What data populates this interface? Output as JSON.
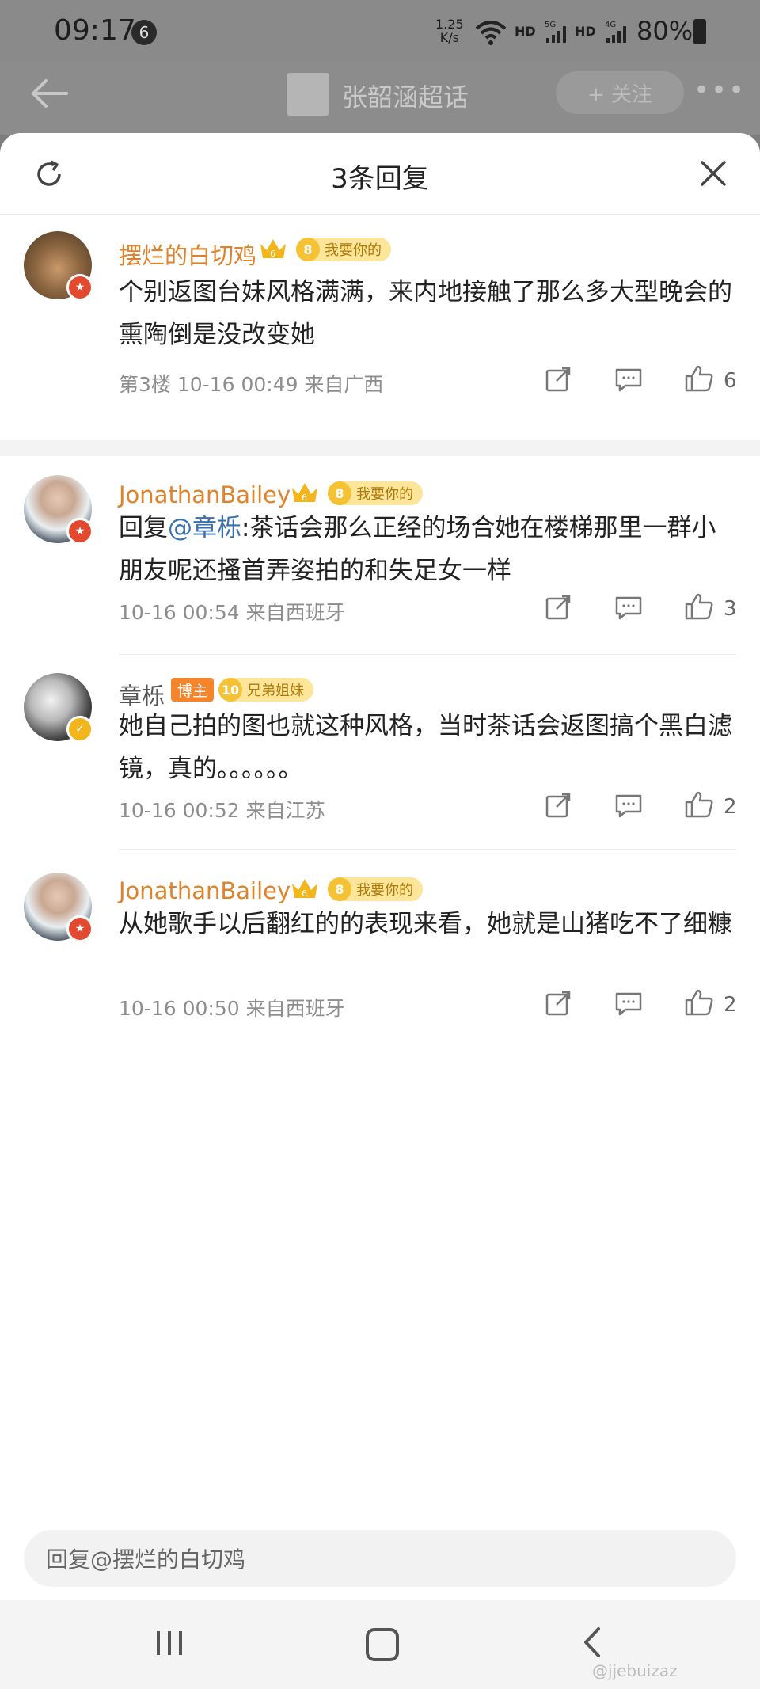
{
  "status_bar": {
    "time": "09:17",
    "notification_count": "6",
    "net_speed_value": "1.25",
    "net_speed_unit": "K/s",
    "hd1": "HD",
    "hd2": "HD",
    "battery": "80%"
  },
  "background_page": {
    "title": "张韶涵超话",
    "follow_label": "+ 关注",
    "more": "•••"
  },
  "sheet": {
    "title": "3条回复"
  },
  "comments": [
    {
      "username": "摆烂的白切鸡",
      "crown_level": "6",
      "fan_level": "8",
      "fan_label": "我要你的",
      "text": "个别返图台妹风格满满，来内地接触了那么多大型晚会的熏陶倒是没改变她",
      "meta": "第3楼 10-16 00:49 来自广西",
      "likes": "6",
      "badge_color": "#e3492f"
    },
    {
      "username": "JonathanBailey",
      "crown_level": "6",
      "fan_level": "8",
      "fan_label": "我要你的",
      "reply_prefix": "回复",
      "mention": "@章栎",
      "text": ":茶话会那么正经的场合她在楼梯那里一群小朋友呢还搔首弄姿拍的和失足女一样",
      "meta": "10-16 00:54 来自西班牙",
      "likes": "3",
      "badge_color": "#e3492f"
    },
    {
      "username": "章栎",
      "blogger_tag": "博主",
      "fan_level": "10",
      "fan_label": "兄弟姐妹",
      "text": "她自己拍的图也就这种风格，当时茶话会返图搞个黑白滤镜，真的。。。。。。",
      "meta": "10-16 00:52 来自江苏",
      "likes": "2",
      "badge_color": "#f3b51c"
    },
    {
      "username": "JonathanBailey",
      "crown_level": "6",
      "fan_level": "8",
      "fan_label": "我要你的",
      "text": "从她歌手以后翻红的的表现来看，她就是山猪吃不了细糠",
      "meta": "10-16 00:50 来自西班牙",
      "likes": "2",
      "badge_color": "#e3492f"
    }
  ],
  "reply_input": {
    "placeholder": "回复@摆烂的白切鸡"
  },
  "watermark": "@jjebuizaz"
}
